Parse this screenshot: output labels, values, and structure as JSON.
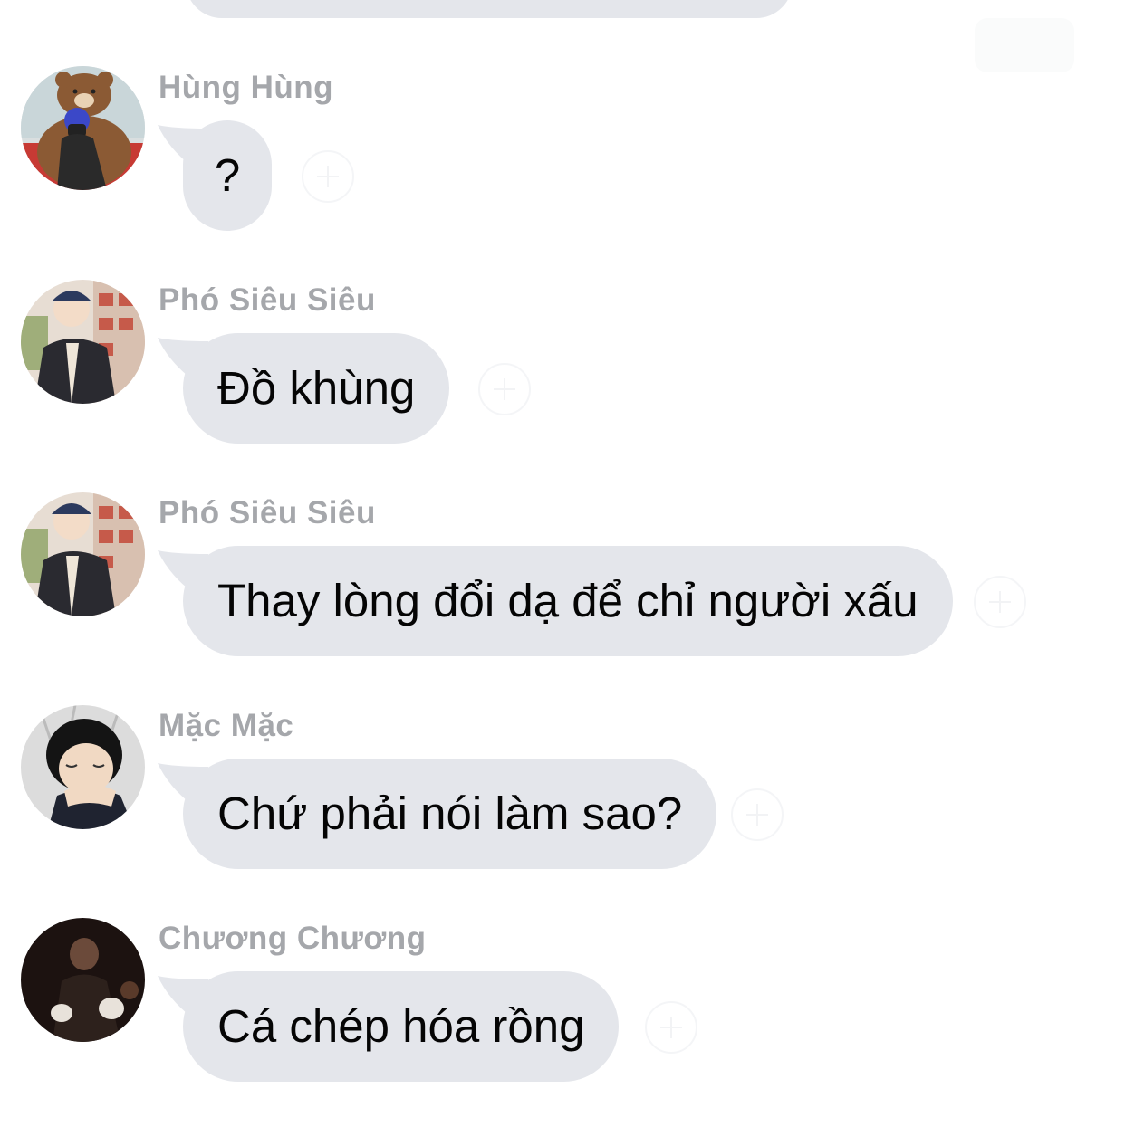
{
  "messages": [
    {
      "sender": "Hùng Hùng",
      "text": "?",
      "avatar": "bear-mascot-photo-avatar"
    },
    {
      "sender": "Phó Siêu Siêu",
      "text": "Đồ khùng",
      "avatar": "boy-cap-photo-avatar"
    },
    {
      "sender": "Phó Siêu Siêu",
      "text": "Thay lòng đổi dạ để chỉ người xấu",
      "avatar": "boy-cap-photo-avatar"
    },
    {
      "sender": "Mặc Mặc",
      "text": "Chứ phải nói làm sao?",
      "avatar": "sleeping-boy-photo-avatar"
    },
    {
      "sender": "Chương Chương",
      "text": "Cá chép hóa rồng",
      "avatar": "dark-photo-avatar"
    }
  ],
  "colors": {
    "bubble": "#e4e6eb",
    "sender_name": "#a5a7ab",
    "message_text": "#050505",
    "background": "#ffffff"
  }
}
